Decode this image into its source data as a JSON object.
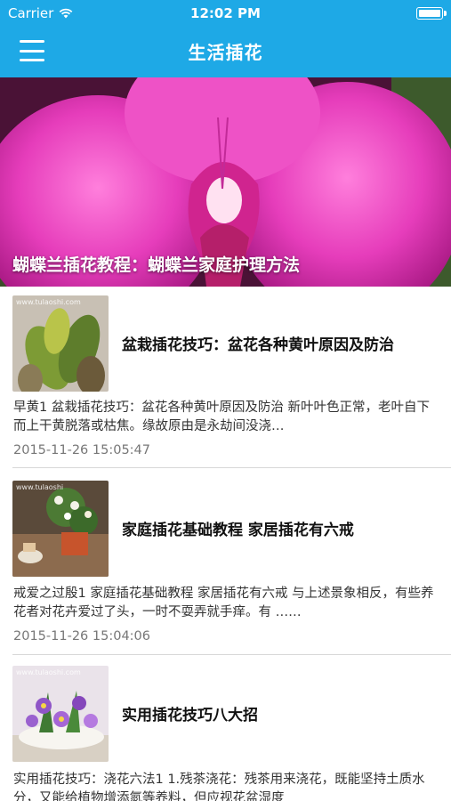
{
  "status_bar": {
    "carrier": "Carrier",
    "time": "12:02 PM",
    "icons": [
      "wifi-icon",
      "battery-icon"
    ]
  },
  "nav": {
    "title": "生活插花",
    "menu_icon": "menu-icon"
  },
  "colors": {
    "accent": "#1ea9e6",
    "date_text": "#777777"
  },
  "hero": {
    "caption": "蝴蝶兰插花教程：蝴蝶兰家庭护理方法"
  },
  "articles": [
    {
      "headline": "盆栽插花技巧：盆花各种黄叶原因及防治",
      "summary": "早黄1 盆栽插花技巧：盆花各种黄叶原因及防治 新叶叶色正常，老叶自下而上干黄脱落或枯焦。缘故原由是永劫间没浇…",
      "date": "2015-11-26 15:05:47",
      "watermark": "www.tulaoshi.com"
    },
    {
      "headline": "家庭插花基础教程 家居插花有六戒",
      "summary": "戒爱之过殷1 家庭插花基础教程 家居插花有六戒 与上述景象相反，有些养花者对花卉爱过了头，一时不耍弄就手痒。有 ……",
      "date": "2015-11-26 15:04:06",
      "watermark": "www.tulaoshi"
    },
    {
      "headline": "实用插花技巧八大招",
      "summary": "实用插花技巧：浇花六法1 1.残茶浇花：残茶用来浇花，既能坚持土质水分，又能给植物增添氮等养料，但应视花盆湿度",
      "date": "",
      "watermark": "www.tulaoshi.com"
    }
  ]
}
